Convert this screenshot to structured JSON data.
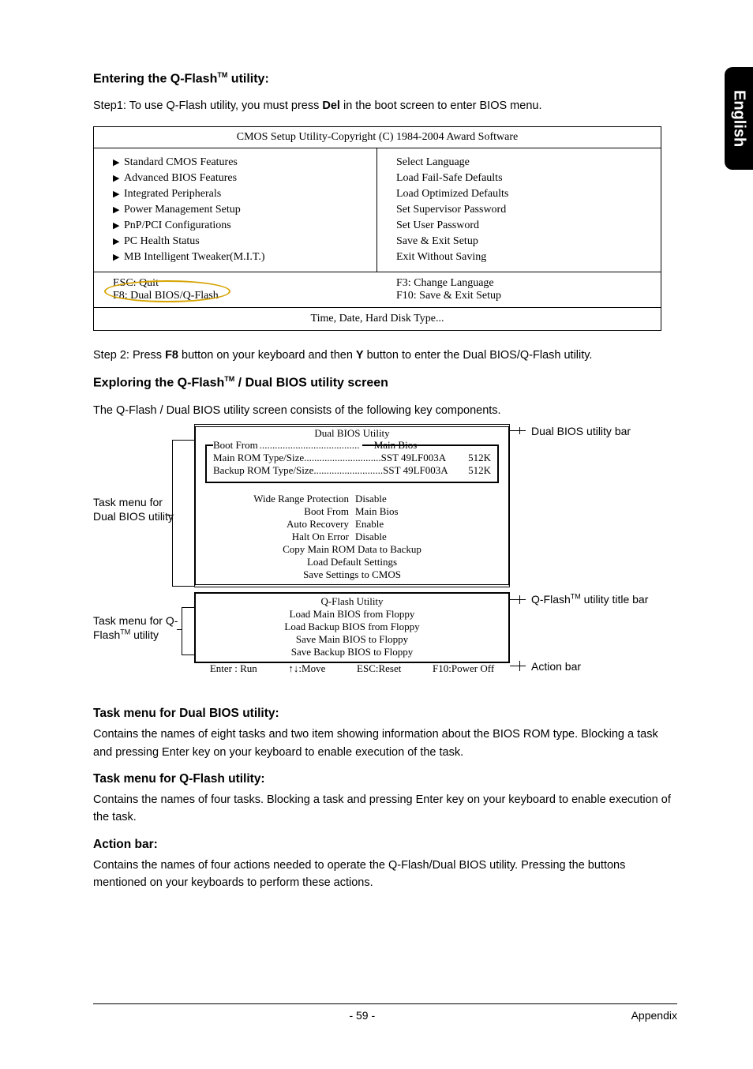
{
  "side_tab": "English",
  "section1": {
    "heading_pre": "Entering the Q-Flash",
    "heading_tm": "TM",
    "heading_post": " utility:",
    "step1_pre": "Step1: To use Q-Flash utility, you must press ",
    "step1_key": "Del",
    "step1_post": " in the boot screen to enter BIOS menu."
  },
  "bios_box": {
    "title": "CMOS Setup Utility-Copyright (C) 1984-2004 Award Software",
    "left_items": [
      "Standard CMOS Features",
      "Advanced BIOS Features",
      "Integrated Peripherals",
      "Power Management Setup",
      "PnP/PCI Configurations",
      "PC Health Status",
      "MB Intelligent Tweaker(M.I.T.)"
    ],
    "right_items": [
      "Select Language",
      "Load Fail-Safe Defaults",
      "Load Optimized Defaults",
      "Set Supervisor Password",
      "Set User Password",
      "Save & Exit Setup",
      "Exit Without Saving"
    ],
    "fkey_left_top": "ESC: Quit",
    "fkey_left_bottom": "F8: Dual BIOS/Q-Flash",
    "fkey_right_top": "F3: Change Language",
    "fkey_right_bottom": "F10: Save & Exit Setup",
    "bottom": "Time, Date, Hard Disk Type..."
  },
  "step2": {
    "pre": "Step 2: Press ",
    "k1": "F8",
    "mid": " button on your keyboard and then ",
    "k2": "Y",
    "post": " button to enter the Dual BIOS/Q-Flash utility."
  },
  "section2": {
    "heading_pre": "Exploring the Q-Flash",
    "heading_tm": "TM",
    "heading_post": " / Dual BIOS utility screen",
    "body": "The Q-Flash / Dual BIOS utility screen consists of the following key components."
  },
  "dual_util": {
    "title": "Dual BIOS Utility",
    "boot_from_label": "Boot From",
    "boot_from_value": "Main Bios",
    "main_rom_label": "Main ROM Type/Size",
    "main_rom_value": "SST 49LF003A",
    "main_rom_size": "512K",
    "backup_rom_label": "Backup ROM Type/Size",
    "backup_rom_value": "SST 49LF003A",
    "backup_rom_size": "512K",
    "settings": [
      {
        "k": "Wide Range Protection",
        "v": "Disable"
      },
      {
        "k": "Boot From",
        "v": "Main Bios"
      },
      {
        "k": "Auto Recovery",
        "v": "Enable"
      },
      {
        "k": "Halt On Error",
        "v": "Disable"
      }
    ],
    "actions_dual": [
      "Copy Main ROM Data to Backup",
      "Load Default Settings",
      "Save Settings to CMOS"
    ],
    "qflash_title": "Q-Flash Utility",
    "qflash_items": [
      "Load Main BIOS from Floppy",
      "Load Backup BIOS from Floppy",
      "Save Main BIOS to Floppy",
      "Save Backup BIOS to Floppy"
    ],
    "action_bar": {
      "a1": "Enter : Run",
      "a2": "↑↓:Move",
      "a3": "ESC:Reset",
      "a4": "F10:Power Off"
    }
  },
  "callouts": {
    "dual_menu": "Task menu for Dual BIOS utility",
    "qflash_menu_pre": "Task menu for Q-Flash",
    "qflash_menu_tm": "TM",
    "qflash_menu_post": " utility",
    "dual_bar": "Dual BIOS utility bar",
    "qflash_bar_pre": "Q-Flash",
    "qflash_bar_tm": "TM",
    "qflash_bar_post": " utility title bar",
    "action_bar": "Action bar"
  },
  "desc": {
    "h1": "Task menu for Dual BIOS utility:",
    "p1": "Contains the names of eight tasks and two item showing information about the BIOS ROM type. Blocking a task and pressing Enter key on your keyboard to enable execution of the task.",
    "h2": "Task menu for Q-Flash utility:",
    "p2": "Contains the names of four tasks. Blocking a task and pressing Enter key on your keyboard to enable execution of the task.",
    "h3": "Action bar:",
    "p3": "Contains the names of four actions needed to operate the Q-Flash/Dual BIOS utility. Pressing the buttons mentioned on your keyboards to perform these actions."
  },
  "footer": {
    "page": "- 59 -",
    "section": "Appendix"
  }
}
